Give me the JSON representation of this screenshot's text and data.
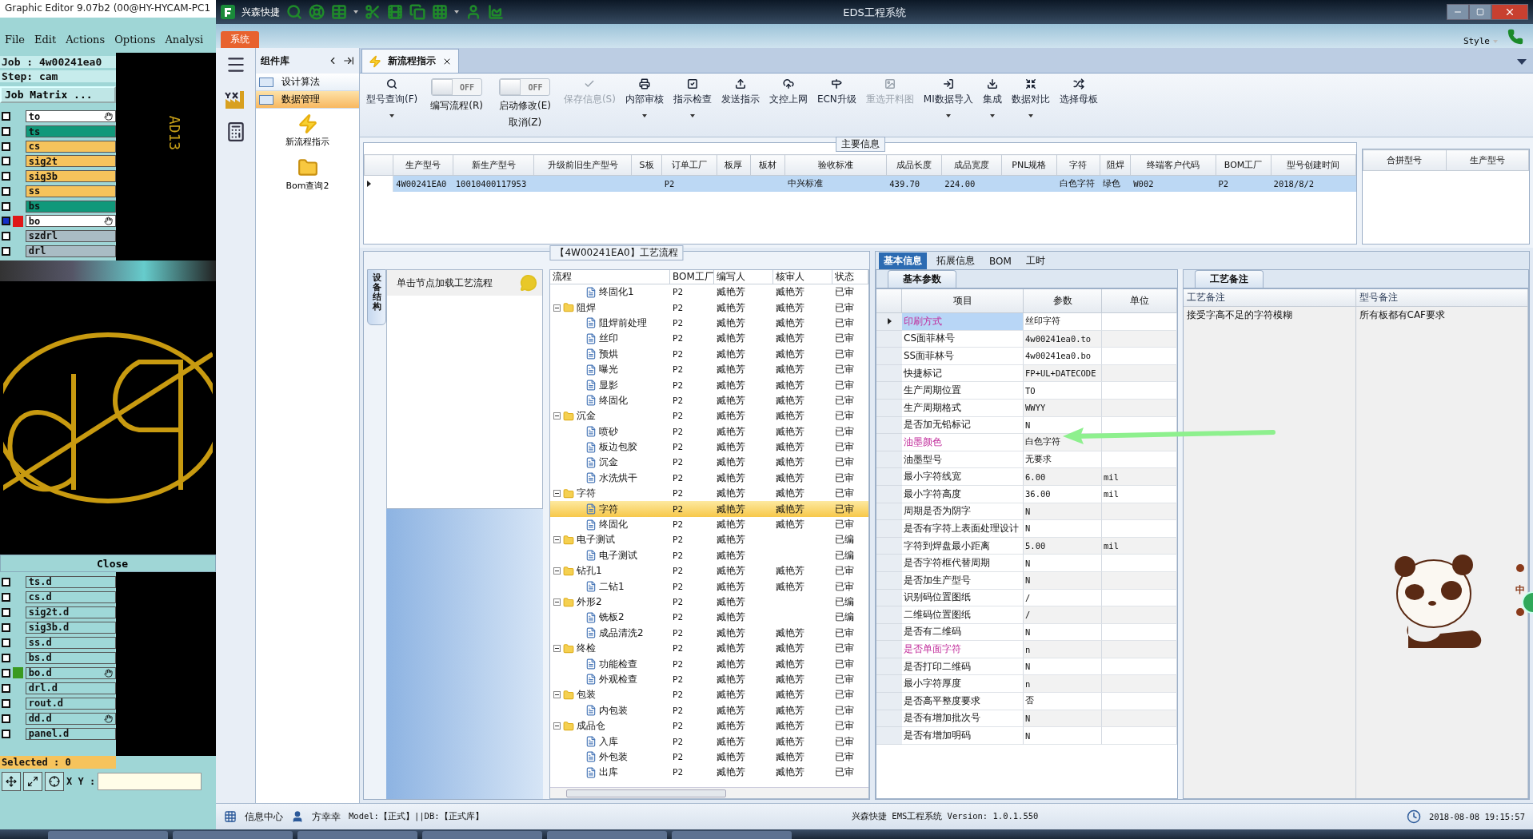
{
  "graphic_editor": {
    "title": "Graphic Editor 9.07b2 (00@HY-HYCAM-PC1",
    "menu": [
      "File",
      "Edit",
      "Actions",
      "Options",
      "Analysi"
    ],
    "job": "Job : 4w00241ea0",
    "step": "Step: cam",
    "matrix_button": "Job Matrix ...",
    "layers": [
      {
        "name": "to",
        "color": "#ffffff",
        "checked": false,
        "pinned": true
      },
      {
        "name": "ts",
        "color": "#10987a",
        "checked": false,
        "pinned": false
      },
      {
        "name": "cs",
        "color": "#f6c35c",
        "checked": false,
        "pinned": false
      },
      {
        "name": "sig2t",
        "color": "#f6c35c",
        "checked": false,
        "pinned": false
      },
      {
        "name": "sig3b",
        "color": "#f6c35c",
        "checked": false,
        "pinned": false
      },
      {
        "name": "ss",
        "color": "#f6c35c",
        "checked": false,
        "pinned": false
      },
      {
        "name": "bs",
        "color": "#10987a",
        "checked": false,
        "pinned": false
      },
      {
        "name": "bo",
        "color": "#ffffff",
        "checked": true,
        "pinned": true,
        "marker": {
          "color": "#e01818"
        }
      },
      {
        "name": "szdrl",
        "color": "#a9bcc4",
        "checked": false,
        "pinned": false
      },
      {
        "name": "drl",
        "color": "#a9bcc4",
        "checked": false,
        "pinned": false
      }
    ],
    "canvas_label": "AD13",
    "close_button": "Close",
    "drill_layers": [
      {
        "name": "ts.d",
        "color": "#9fd8d8",
        "checked": false,
        "pinned": false
      },
      {
        "name": "cs.d",
        "color": "#9fd8d8",
        "checked": false,
        "pinned": false
      },
      {
        "name": "sig2t.d",
        "color": "#9fd8d8",
        "checked": false,
        "pinned": false
      },
      {
        "name": "sig3b.d",
        "color": "#9fd8d8",
        "checked": false,
        "pinned": false
      },
      {
        "name": "ss.d",
        "color": "#9fd8d8",
        "checked": false,
        "pinned": false
      },
      {
        "name": "bs.d",
        "color": "#9fd8d8",
        "checked": false,
        "pinned": false
      },
      {
        "name": "bo.d",
        "color": "#9fd8d8",
        "checked": false,
        "pinned": true,
        "marker": {
          "color": "#3a9a20"
        }
      },
      {
        "name": "drl.d",
        "color": "#9fd8d8",
        "checked": false,
        "pinned": false
      },
      {
        "name": "rout.d",
        "color": "#9fd8d8",
        "checked": false,
        "pinned": false
      },
      {
        "name": "dd.d",
        "color": "#9fd8d8",
        "checked": false,
        "pinned": true
      },
      {
        "name": "panel.d",
        "color": "#9fd8d8",
        "checked": false,
        "pinned": false
      }
    ],
    "selected_count": "Selected : 0",
    "xy_label": "X Y :"
  },
  "window": {
    "app_name": "兴森快捷",
    "title": "EDS工程系统"
  },
  "ribbon": {
    "tab": "系统",
    "style_menu": "Style"
  },
  "component_library": {
    "title": "组件库",
    "categories": [
      {
        "label": "设计算法",
        "selected": false
      },
      {
        "label": "数据管理",
        "selected": true
      }
    ],
    "items": [
      {
        "label": "新流程指示"
      },
      {
        "label": "Bom查询2"
      }
    ]
  },
  "document_tab": {
    "label": "新流程指示",
    "selected": true
  },
  "toolbar": [
    {
      "kind": "button",
      "label": "型号查询(F)",
      "dropdown": true,
      "disabled": false
    },
    {
      "kind": "toggle",
      "label": "编写流程(R)",
      "state_label": "OFF",
      "on": false
    },
    {
      "kind": "toggle",
      "label": "启动修改(E)",
      "sublabel": "取消(Z)",
      "state_label": "OFF",
      "on": false
    },
    {
      "kind": "button",
      "label": "保存信息(S)",
      "dropdown": false,
      "disabled": true
    },
    {
      "kind": "button",
      "label": "内部审核",
      "dropdown": true,
      "disabled": false
    },
    {
      "kind": "button",
      "label": "指示检查",
      "dropdown": true,
      "disabled": false
    },
    {
      "kind": "button",
      "label": "发送指示",
      "dropdown": false,
      "disabled": false
    },
    {
      "kind": "button",
      "label": "文控上网",
      "dropdown": false,
      "disabled": false
    },
    {
      "kind": "button",
      "label": "ECN升级",
      "dropdown": false,
      "disabled": false
    },
    {
      "kind": "button",
      "label": "重选开料图",
      "dropdown": false,
      "disabled": true
    },
    {
      "kind": "button",
      "label": "MI数据导入",
      "dropdown": true,
      "disabled": false
    },
    {
      "kind": "button",
      "label": "集成",
      "dropdown": true,
      "disabled": false
    },
    {
      "kind": "button",
      "label": "数据对比",
      "dropdown": true,
      "disabled": false
    },
    {
      "kind": "button",
      "label": "选择母板",
      "dropdown": false,
      "disabled": false
    }
  ],
  "main_info": {
    "title": "主要信息",
    "columns": [
      "生产型号",
      "新生产型号",
      "升级前旧生产型号",
      "S板",
      "订单工厂",
      "板厚",
      "板材",
      "验收标准",
      "成品长度",
      "成品宽度",
      "PNL规格",
      "字符",
      "阻焊",
      "终端客户代码",
      "BOM工厂",
      "型号创建时间"
    ],
    "rows": [
      {
        "selected": true,
        "cells": [
          "4W00241EA0",
          "10010400117953",
          "",
          "",
          "P2",
          "",
          "",
          "中兴标准",
          "439.70",
          "224.00",
          "",
          "白色字符",
          "绿色",
          "W002",
          "P2",
          "2018/8/2"
        ]
      }
    ],
    "merge_columns": [
      "合拼型号",
      "生产型号"
    ]
  },
  "workflow": {
    "title": "【4W00241EA0】工艺流程",
    "side_tab": "设备结构",
    "hint": "单击节点加载工艺流程",
    "columns": [
      "流程",
      "BOM工厂",
      "编写人",
      "核审人",
      "状态"
    ],
    "tree": [
      {
        "kind": "step",
        "name": "终固化1",
        "bom": "P2",
        "author": "臧艳芳",
        "reviewer": "臧艳芳",
        "status": "已审",
        "selected": false
      },
      {
        "kind": "group",
        "name": "阻焊",
        "bom": "P2",
        "author": "臧艳芳",
        "reviewer": "臧艳芳",
        "status": "已审",
        "selected": false,
        "expanded": true,
        "children": [
          {
            "kind": "step",
            "name": "阻焊前处理",
            "bom": "P2",
            "author": "臧艳芳",
            "reviewer": "臧艳芳",
            "status": "已审",
            "selected": false
          },
          {
            "kind": "step",
            "name": "丝印",
            "bom": "P2",
            "author": "臧艳芳",
            "reviewer": "臧艳芳",
            "status": "已审",
            "selected": false
          },
          {
            "kind": "step",
            "name": "预烘",
            "bom": "P2",
            "author": "臧艳芳",
            "reviewer": "臧艳芳",
            "status": "已审",
            "selected": false
          },
          {
            "kind": "step",
            "name": "曝光",
            "bom": "P2",
            "author": "臧艳芳",
            "reviewer": "臧艳芳",
            "status": "已审",
            "selected": false
          },
          {
            "kind": "step",
            "name": "显影",
            "bom": "P2",
            "author": "臧艳芳",
            "reviewer": "臧艳芳",
            "status": "已审",
            "selected": false
          },
          {
            "kind": "step",
            "name": "终固化",
            "bom": "P2",
            "author": "臧艳芳",
            "reviewer": "臧艳芳",
            "status": "已审",
            "selected": false
          }
        ]
      },
      {
        "kind": "group",
        "name": "沉金",
        "bom": "P2",
        "author": "臧艳芳",
        "reviewer": "臧艳芳",
        "status": "已审",
        "selected": false,
        "expanded": true,
        "children": [
          {
            "kind": "step",
            "name": "喷砂",
            "bom": "P2",
            "author": "臧艳芳",
            "reviewer": "臧艳芳",
            "status": "已审",
            "selected": false
          },
          {
            "kind": "step",
            "name": "板边包胶",
            "bom": "P2",
            "author": "臧艳芳",
            "reviewer": "臧艳芳",
            "status": "已审",
            "selected": false
          },
          {
            "kind": "step",
            "name": "沉金",
            "bom": "P2",
            "author": "臧艳芳",
            "reviewer": "臧艳芳",
            "status": "已审",
            "selected": false
          },
          {
            "kind": "step",
            "name": "水洗烘干",
            "bom": "P2",
            "author": "臧艳芳",
            "reviewer": "臧艳芳",
            "status": "已审",
            "selected": false
          }
        ]
      },
      {
        "kind": "group",
        "name": "字符",
        "bom": "P2",
        "author": "臧艳芳",
        "reviewer": "臧艳芳",
        "status": "已审",
        "selected": false,
        "expanded": true,
        "children": [
          {
            "kind": "step",
            "name": "字符",
            "bom": "P2",
            "author": "臧艳芳",
            "reviewer": "臧艳芳",
            "status": "已审",
            "selected": true
          },
          {
            "kind": "step",
            "name": "终固化",
            "bom": "P2",
            "author": "臧艳芳",
            "reviewer": "臧艳芳",
            "status": "已审",
            "selected": false
          }
        ]
      },
      {
        "kind": "group",
        "name": "电子测试",
        "bom": "P2",
        "author": "臧艳芳",
        "status": "已编",
        "selected": false,
        "expanded": true,
        "children": [
          {
            "kind": "step",
            "name": "电子测试",
            "bom": "P2",
            "author": "臧艳芳",
            "status": "已编",
            "selected": false
          }
        ]
      },
      {
        "kind": "group",
        "name": "钻孔1",
        "bom": "P2",
        "author": "臧艳芳",
        "reviewer": "臧艳芳",
        "status": "已审",
        "selected": false,
        "expanded": true,
        "children": [
          {
            "kind": "step",
            "name": "二钻1",
            "bom": "P2",
            "author": "臧艳芳",
            "reviewer": "臧艳芳",
            "status": "已审",
            "selected": false
          }
        ]
      },
      {
        "kind": "group",
        "name": "外形2",
        "bom": "P2",
        "author": "臧艳芳",
        "status": "已编",
        "selected": false,
        "expanded": true,
        "children": [
          {
            "kind": "step",
            "name": "铣板2",
            "bom": "P2",
            "author": "臧艳芳",
            "status": "已编",
            "selected": false
          },
          {
            "kind": "step",
            "name": "成品清洗2",
            "bom": "P2",
            "author": "臧艳芳",
            "reviewer": "臧艳芳",
            "status": "已审",
            "selected": false
          }
        ]
      },
      {
        "kind": "group",
        "name": "终检",
        "bom": "P2",
        "author": "臧艳芳",
        "reviewer": "臧艳芳",
        "status": "已审",
        "selected": false,
        "expanded": true,
        "children": [
          {
            "kind": "step",
            "name": "功能检查",
            "bom": "P2",
            "author": "臧艳芳",
            "reviewer": "臧艳芳",
            "status": "已审",
            "selected": false
          },
          {
            "kind": "step",
            "name": "外观检查",
            "bom": "P2",
            "author": "臧艳芳",
            "reviewer": "臧艳芳",
            "status": "已审",
            "selected": false
          }
        ]
      },
      {
        "kind": "group",
        "name": "包装",
        "bom": "P2",
        "author": "臧艳芳",
        "reviewer": "臧艳芳",
        "status": "已审",
        "selected": false,
        "expanded": true,
        "children": [
          {
            "kind": "step",
            "name": "内包装",
            "bom": "P2",
            "author": "臧艳芳",
            "reviewer": "臧艳芳",
            "status": "已审",
            "selected": false
          }
        ]
      },
      {
        "kind": "group",
        "name": "成品仓",
        "bom": "P2",
        "author": "臧艳芳",
        "reviewer": "臧艳芳",
        "status": "已审",
        "selected": false,
        "expanded": true,
        "children": [
          {
            "kind": "step",
            "name": "入库",
            "bom": "P2",
            "author": "臧艳芳",
            "reviewer": "臧艳芳",
            "status": "已审",
            "selected": false
          },
          {
            "kind": "step",
            "name": "外包装",
            "bom": "P2",
            "author": "臧艳芳",
            "reviewer": "臧艳芳",
            "status": "已审",
            "selected": false
          },
          {
            "kind": "step",
            "name": "出库",
            "bom": "P2",
            "author": "臧艳芳",
            "reviewer": "臧艳芳",
            "status": "已审",
            "selected": false
          }
        ]
      }
    ]
  },
  "detail_tabs": [
    {
      "label": "基本信息",
      "selected": true
    },
    {
      "label": "拓展信息",
      "selected": false
    },
    {
      "label": "BOM",
      "selected": false
    },
    {
      "label": "工时",
      "selected": false
    }
  ],
  "parameters": {
    "tab": "基本参数",
    "columns": [
      "项目",
      "参数",
      "单位"
    ],
    "rows": [
      {
        "name": "印刷方式",
        "value": "丝印字符",
        "unit": "",
        "emphasis": true,
        "selected": true
      },
      {
        "name": "CS面菲林号",
        "value": "4w00241ea0.to",
        "unit": "",
        "emphasis": false,
        "selected": false
      },
      {
        "name": "SS面菲林号",
        "value": "4w00241ea0.bo",
        "unit": "",
        "emphasis": false,
        "selected": false
      },
      {
        "name": "快捷标记",
        "value": "FP+UL+DATECODE",
        "unit": "",
        "emphasis": false,
        "selected": false
      },
      {
        "name": "生产周期位置",
        "value": "TO",
        "unit": "",
        "emphasis": false,
        "selected": false
      },
      {
        "name": "生产周期格式",
        "value": "WWYY",
        "unit": "",
        "emphasis": false,
        "selected": false
      },
      {
        "name": "是否加无铅标记",
        "value": "N",
        "unit": "",
        "emphasis": false,
        "selected": false
      },
      {
        "name": "油墨颜色",
        "value": "白色字符",
        "unit": "",
        "emphasis": true,
        "selected": false
      },
      {
        "name": "油墨型号",
        "value": "无要求",
        "unit": "",
        "emphasis": false,
        "selected": false
      },
      {
        "name": "最小字符线宽",
        "value": "6.00",
        "unit": "mil",
        "emphasis": false,
        "selected": false
      },
      {
        "name": "最小字符高度",
        "value": "36.00",
        "unit": "mil",
        "emphasis": false,
        "selected": false
      },
      {
        "name": "周期是否为阴字",
        "value": "N",
        "unit": "",
        "emphasis": false,
        "selected": false
      },
      {
        "name": "是否有字符上表面处理设计",
        "value": "N",
        "unit": "",
        "emphasis": false,
        "selected": false
      },
      {
        "name": "字符到焊盘最小距离",
        "value": "5.00",
        "unit": "mil",
        "emphasis": false,
        "selected": false
      },
      {
        "name": "是否字符框代替周期",
        "value": "N",
        "unit": "",
        "emphasis": false,
        "selected": false
      },
      {
        "name": "是否加生产型号",
        "value": "N",
        "unit": "",
        "emphasis": false,
        "selected": false
      },
      {
        "name": "识别码位置图纸",
        "value": "/",
        "unit": "",
        "emphasis": false,
        "selected": false
      },
      {
        "name": "二维码位置图纸",
        "value": "/",
        "unit": "",
        "emphasis": false,
        "selected": false
      },
      {
        "name": "是否有二维码",
        "value": "N",
        "unit": "",
        "emphasis": false,
        "selected": false
      },
      {
        "name": "是否单面字符",
        "value": "n",
        "unit": "",
        "emphasis": true,
        "selected": false
      },
      {
        "name": "是否打印二维码",
        "value": "N",
        "unit": "",
        "emphasis": false,
        "selected": false
      },
      {
        "name": "最小字符厚度",
        "value": "n",
        "unit": "",
        "emphasis": false,
        "selected": false
      },
      {
        "name": "是否高平整度要求",
        "value": "否",
        "unit": "",
        "emphasis": false,
        "selected": false
      },
      {
        "name": "是否有增加批次号",
        "value": "N",
        "unit": "",
        "emphasis": false,
        "selected": false
      },
      {
        "name": "是否有增加明码",
        "value": "N",
        "unit": "",
        "emphasis": false,
        "selected": false
      }
    ]
  },
  "notes": {
    "tab": "工艺备注",
    "columns": [
      {
        "title": "工艺备注",
        "text": "接受字高不足的字符模糊"
      },
      {
        "title": "型号备注",
        "text": "所有板都有CAF要求"
      }
    ]
  },
  "ime": {
    "label": "中"
  },
  "status_bar": {
    "info_center": "信息中心",
    "user": "方幸幸",
    "environment": "Model:【正式】||DB:【正式库】",
    "version": "兴森快捷 EMS工程系统 Version: 1.0.1.550",
    "datetime": "2018-08-08 19:15:57"
  }
}
